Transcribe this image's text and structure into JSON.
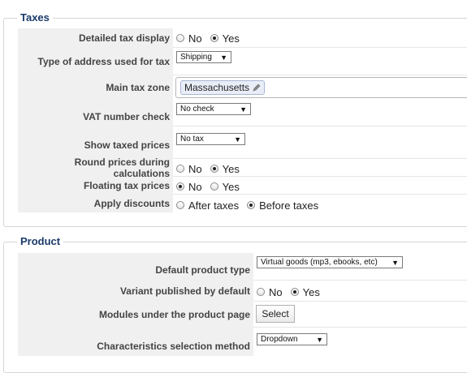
{
  "taxes": {
    "title": "Taxes",
    "detailed_tax_display": {
      "label": "Detailed tax display",
      "options": [
        "No",
        "Yes"
      ],
      "selected": "Yes"
    },
    "address_type": {
      "label": "Type of address used for tax",
      "value": "Shipping"
    },
    "main_tax_zone": {
      "label": "Main tax zone",
      "value": "Massachusetts"
    },
    "vat_check": {
      "label": "VAT number check",
      "value": "No check"
    },
    "show_taxed_prices": {
      "label": "Show taxed prices",
      "value": "No tax"
    },
    "round_prices": {
      "label": "Round prices during calculations",
      "options": [
        "No",
        "Yes"
      ],
      "selected": "Yes"
    },
    "floating_tax_prices": {
      "label": "Floating tax prices",
      "options": [
        "No",
        "Yes"
      ],
      "selected": "No"
    },
    "apply_discounts": {
      "label": "Apply discounts",
      "options": [
        "After taxes",
        "Before taxes"
      ],
      "selected": "Before taxes"
    }
  },
  "product": {
    "title": "Product",
    "default_product_type": {
      "label": "Default product type",
      "value": "Virtual goods (mp3, ebooks, etc)"
    },
    "variant_published": {
      "label": "Variant published by default",
      "options": [
        "No",
        "Yes"
      ],
      "selected": "Yes"
    },
    "modules_under_page": {
      "label": "Modules under the product page",
      "button": "Select"
    },
    "characteristics_method": {
      "label": "Characteristics selection method",
      "value": "Dropdown"
    }
  },
  "icons": {
    "edit": "pencil-icon",
    "dropdown": "chevron-down-icon"
  }
}
